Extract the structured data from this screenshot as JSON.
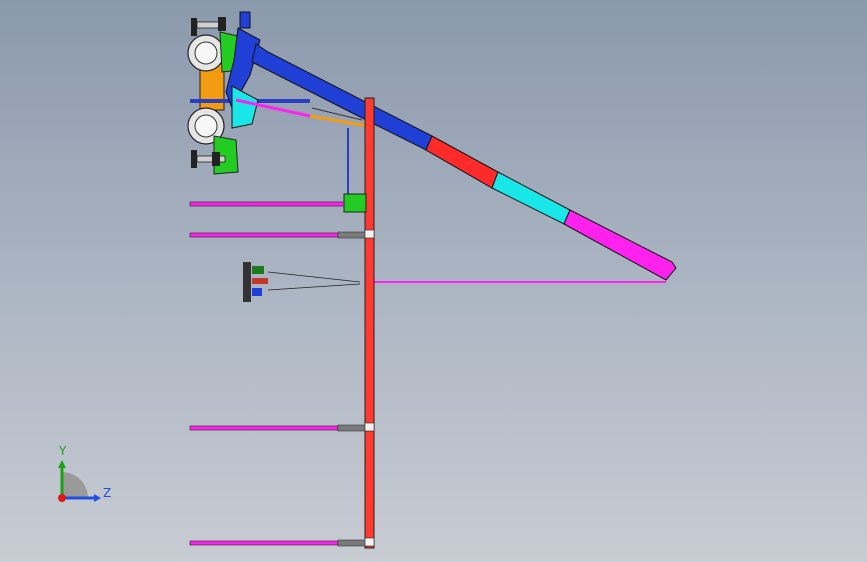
{
  "viewport": {
    "background_top": "#8b99ad",
    "background_bottom": "#c8ccd3"
  },
  "model": {
    "components": [
      {
        "name": "vehicle-chassis",
        "color": "#f39c12"
      },
      {
        "name": "front-fender",
        "color": "#22cc22"
      },
      {
        "name": "crane-boom-base",
        "color": "#1f3fd6"
      },
      {
        "name": "crane-boom-section-2",
        "color": "#ff2a2a"
      },
      {
        "name": "crane-boom-section-3",
        "color": "#19e6e6"
      },
      {
        "name": "crane-boom-tip",
        "color": "#ff22ee"
      },
      {
        "name": "vertical-mast",
        "color": "#ff3a30"
      },
      {
        "name": "horizontal-arms",
        "color": "#ff22ee"
      }
    ],
    "arms_count": 5
  },
  "triad": {
    "y_label": "Y",
    "z_label": "Z",
    "y_color": "#1aa31a",
    "z_color": "#1f4fe0",
    "origin_color": "#e01818"
  }
}
